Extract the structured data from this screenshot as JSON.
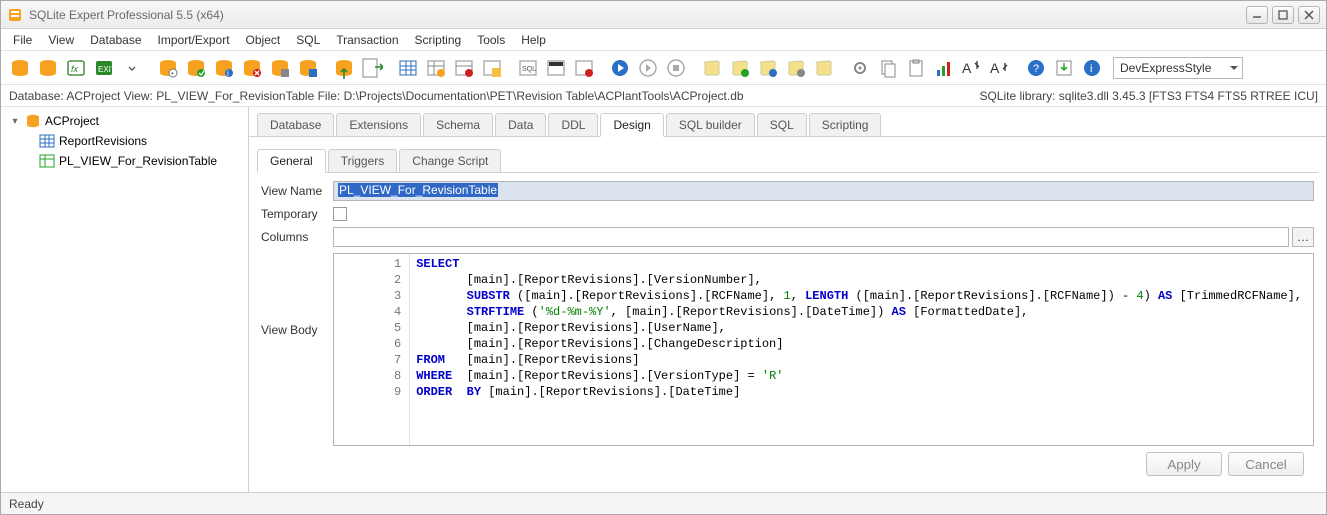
{
  "titlebar": {
    "title": "SQLite Expert Professional 5.5 (x64)"
  },
  "menu": [
    "File",
    "View",
    "Database",
    "Import/Export",
    "Object",
    "SQL",
    "Transaction",
    "Scripting",
    "Tools",
    "Help"
  ],
  "theme_selected": "DevExpressStyle",
  "infobar_left": "Database: ACProject   View: PL_VIEW_For_RevisionTable   File: D:\\Projects\\Documentation\\PET\\Revision Table\\ACPlantTools\\ACProject.db",
  "infobar_right": "SQLite library: sqlite3.dll 3.45.3 [FTS3 FTS4 FTS5 RTREE ICU]",
  "tree": {
    "root": "ACProject",
    "children": [
      "ReportRevisions",
      "PL_VIEW_For_RevisionTable"
    ]
  },
  "tabs_main": [
    "Database",
    "Extensions",
    "Schema",
    "Data",
    "DDL",
    "Design",
    "SQL builder",
    "SQL",
    "Scripting"
  ],
  "tabs_main_active": 5,
  "tabs_sub": [
    "General",
    "Triggers",
    "Change Script"
  ],
  "tabs_sub_active": 0,
  "form": {
    "view_name_label": "View Name",
    "view_name_value": "PL_VIEW_For_RevisionTable",
    "temporary_label": "Temporary",
    "temporary_checked": false,
    "columns_label": "Columns",
    "columns_value": "",
    "view_body_label": "View Body"
  },
  "sql_lines": [
    {
      "n": 1,
      "html": "<span class='kw'>SELECT</span>"
    },
    {
      "n": 2,
      "html": "       [main].[ReportRevisions].[VersionNumber],"
    },
    {
      "n": 3,
      "html": "       <span class='kw'>SUBSTR</span> ([main].[ReportRevisions].[RCFName], <span class='num'>1</span>, <span class='kw'>LENGTH</span> ([main].[ReportRevisions].[RCFName]) - <span class='num'>4</span>) <span class='kw'>AS</span> [TrimmedRCFName],"
    },
    {
      "n": 4,
      "html": "       <span class='kw'>STRFTIME</span> (<span class='str'>'%d-%m-%Y'</span>, [main].[ReportRevisions].[DateTime]) <span class='kw'>AS</span> [FormattedDate],"
    },
    {
      "n": 5,
      "html": "       [main].[ReportRevisions].[UserName],"
    },
    {
      "n": 6,
      "html": "       [main].[ReportRevisions].[ChangeDescription]"
    },
    {
      "n": 7,
      "html": "<span class='kw'>FROM</span>   [main].[ReportRevisions]"
    },
    {
      "n": 8,
      "html": "<span class='kw'>WHERE</span>  [main].[ReportRevisions].[VersionType] = <span class='str'>'R'</span>"
    },
    {
      "n": 9,
      "html": "<span class='kw'>ORDER</span>  <span class='kw'>BY</span> [main].[ReportRevisions].[DateTime]"
    }
  ],
  "buttons": {
    "apply": "Apply",
    "cancel": "Cancel"
  },
  "statusbar": "Ready"
}
